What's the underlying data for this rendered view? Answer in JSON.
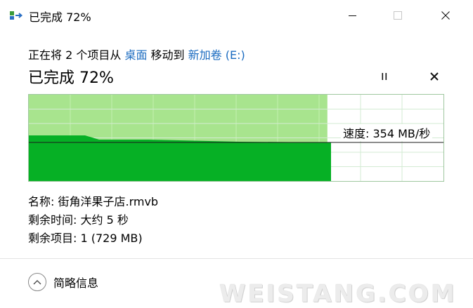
{
  "window": {
    "title": "已完成 72%",
    "icon": "copy-move-icon"
  },
  "subtitle": {
    "prefix": "正在将 2 个项目从 ",
    "source": "桌面",
    "middle": " 移动到 ",
    "destination": "新加卷 (E:)"
  },
  "progress": {
    "heading": "已完成 72%",
    "percent": 72,
    "speed_label": "速度: 354 MB/秒"
  },
  "details": {
    "name": "名称: 街角洋果子店.rmvb",
    "time_remaining": "剩余时间: 大约 5 秒",
    "items_remaining": "剩余项目: 1 (729 MB)"
  },
  "footer": {
    "less_details": "简略信息"
  },
  "watermark": "WEISTANG.COM",
  "colors": {
    "graph_light": "#a8e48e",
    "graph_dark": "#06b025",
    "grid": "#d3ebd3",
    "link": "#1a6bc0"
  }
}
